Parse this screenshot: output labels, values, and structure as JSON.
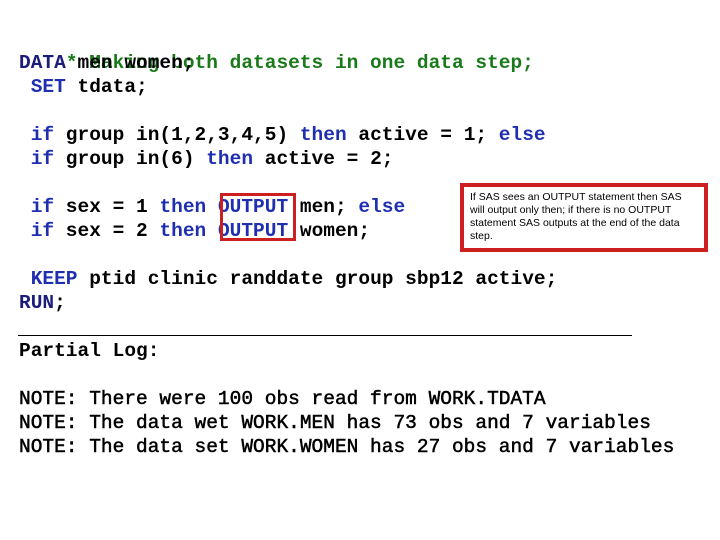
{
  "code": {
    "line1": {
      "text": "* Making both datasets in one data step;"
    },
    "line2": {
      "kw": "DATA",
      "rest": " men women;"
    },
    "line3": {
      "indent": " ",
      "kw": "SET",
      "rest": " tdata;"
    },
    "line4": {
      "indent": " ",
      "kw1": "if",
      "mid1": " group in(1,2,3,4,5) ",
      "kw2": "then",
      "mid2": " active = 1; ",
      "kw3": "else"
    },
    "line5": {
      "indent": " ",
      "kw1": "if",
      "mid1": " group in(6) ",
      "kw2": "then",
      "mid2": " active = 2;"
    },
    "line6": {
      "indent": " ",
      "kw1": "if",
      "mid1": " sex = 1 ",
      "kw2": "then",
      "space": " ",
      "kw3": "OUTPUT",
      "mid2": " men; ",
      "kw4": "else"
    },
    "line7": {
      "indent": " ",
      "kw1": "if",
      "mid1": " sex = 2 ",
      "kw2": "then",
      "space": " ",
      "kw3": "OUTPUT",
      "mid2": " women;"
    },
    "line8": {
      "indent": " ",
      "kw": "KEEP",
      "rest": " ptid clinic randdate group sbp12 active;"
    },
    "line9": {
      "kw": "RUN",
      "rest": ";"
    }
  },
  "callout": {
    "text": "If SAS sees an OUTPUT statement then SAS will output only then; if there is no OUTPUT statement SAS outputs at the end of the data step."
  },
  "log": {
    "heading": "Partial Log:",
    "lines": [
      "NOTE: There were 100 obs read from WORK.TDATA",
      "NOTE: The data wet WORK.MEN has 73 obs and 7 variables",
      "NOTE: The data set WORK.WOMEN has 27 obs and 7 variables"
    ]
  },
  "colors": {
    "comment": "#1a7a1a",
    "keyword": "#1f2fb0",
    "highlight_border": "#cc1f1f"
  }
}
